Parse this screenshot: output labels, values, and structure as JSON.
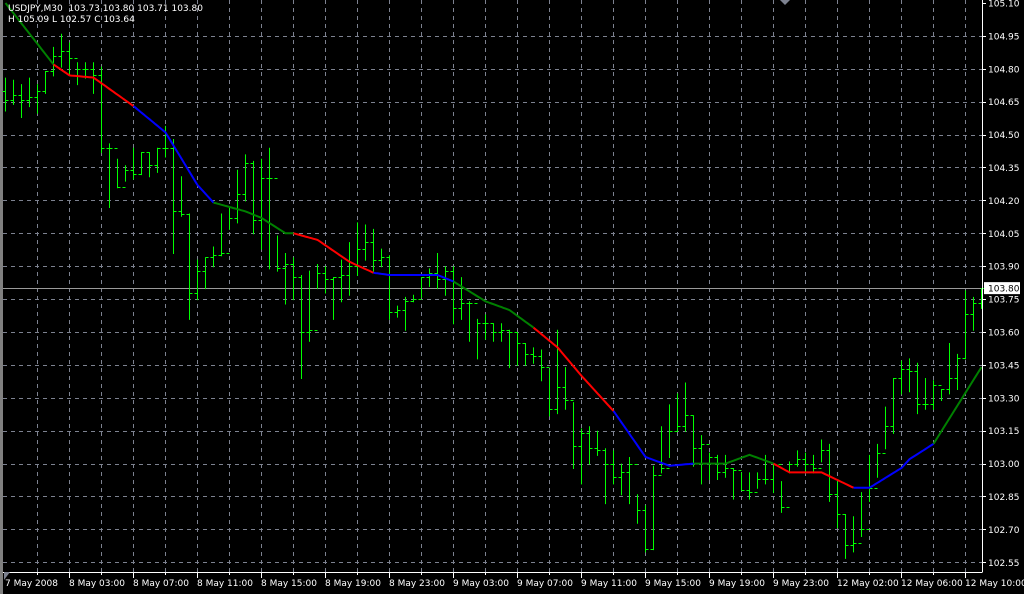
{
  "header": {
    "symbol_line": "USDJPY,M30  103.73 103.80 103.71 103.80",
    "range_line": "H 105.09 L 102.57 C 103.64"
  },
  "colors": {
    "background": "#000000",
    "bars": "#00ff00",
    "grid": "#7d8290",
    "axis": "#ffffff",
    "bid_line": "#9a9a9a",
    "ma_green": "#008000",
    "ma_red": "#ff0000",
    "ma_blue": "#0000ff"
  },
  "chart_data": {
    "type": "ohlc",
    "symbol": "USDJPY",
    "timeframe": "M30",
    "ylim": [
      102.55,
      105.1
    ],
    "grid": true,
    "price_ticks": [
      "105.10",
      "104.95",
      "104.80",
      "104.65",
      "104.50",
      "104.35",
      "104.20",
      "104.05",
      "103.90",
      "103.75",
      "103.60",
      "103.45",
      "103.30",
      "103.15",
      "103.00",
      "102.85",
      "102.70",
      "102.55"
    ],
    "current_price": "103.80",
    "time_labels": [
      "7 May 2008",
      "8 May 03:00",
      "8 May 07:00",
      "8 May 11:00",
      "8 May 15:00",
      "8 May 19:00",
      "8 May 23:00",
      "9 May 03:00",
      "9 May 07:00",
      "9 May 11:00",
      "9 May 15:00",
      "9 May 19:00",
      "9 May 23:00",
      "12 May 02:00",
      "12 May 06:00",
      "12 May 10:00"
    ],
    "bars_hlc": [
      [
        104.76,
        104.61,
        104.66
      ],
      [
        104.75,
        104.64,
        104.68
      ],
      [
        104.73,
        104.58,
        104.66
      ],
      [
        104.76,
        104.63,
        104.67
      ],
      [
        104.73,
        104.6,
        104.7
      ],
      [
        104.79,
        104.69,
        104.79
      ],
      [
        104.9,
        104.77,
        104.86
      ],
      [
        104.96,
        104.81,
        104.88
      ],
      [
        104.92,
        104.78,
        104.85
      ],
      [
        104.83,
        104.73,
        104.8
      ],
      [
        104.83,
        104.76,
        104.8
      ],
      [
        104.83,
        104.69,
        104.77
      ],
      [
        104.81,
        104.42,
        104.44
      ],
      [
        104.46,
        104.17,
        104.44
      ],
      [
        104.39,
        104.26,
        104.26
      ],
      [
        104.36,
        104.29,
        104.34
      ],
      [
        104.44,
        104.3,
        104.32
      ],
      [
        104.42,
        104.32,
        104.42
      ],
      [
        104.42,
        104.31,
        104.36
      ],
      [
        104.44,
        104.33,
        104.44
      ],
      [
        104.54,
        104.4,
        104.44
      ],
      [
        104.48,
        103.96,
        104.15
      ],
      [
        104.31,
        104.13,
        104.14
      ],
      [
        104.14,
        103.66,
        103.78
      ],
      [
        103.93,
        103.75,
        103.88
      ],
      [
        103.94,
        103.8,
        103.94
      ],
      [
        103.99,
        103.9,
        103.95
      ],
      [
        104.14,
        103.95,
        103.96
      ],
      [
        104.17,
        104.07,
        104.12
      ],
      [
        104.34,
        104.1,
        104.23
      ],
      [
        104.41,
        104.2,
        104.37
      ],
      [
        104.38,
        104.05,
        104.11
      ],
      [
        104.39,
        103.98,
        104.3
      ],
      [
        104.44,
        103.89,
        104.3
      ],
      [
        104.04,
        103.88,
        103.89
      ],
      [
        103.96,
        103.73,
        103.91
      ],
      [
        103.94,
        103.75,
        103.85
      ],
      [
        103.86,
        103.39,
        103.6
      ],
      [
        103.88,
        103.56,
        103.61
      ],
      [
        103.91,
        103.8,
        103.87
      ],
      [
        103.9,
        103.78,
        103.84
      ],
      [
        103.85,
        103.66,
        103.85
      ],
      [
        103.93,
        103.74,
        103.86
      ],
      [
        104.01,
        103.77,
        103.9
      ],
      [
        104.1,
        103.86,
        103.98
      ],
      [
        104.09,
        103.93,
        104.01
      ],
      [
        104.07,
        103.88,
        103.93
      ],
      [
        103.98,
        103.9,
        103.94
      ],
      [
        103.95,
        103.66,
        103.69
      ],
      [
        103.72,
        103.67,
        103.7
      ],
      [
        103.76,
        103.61,
        103.74
      ],
      [
        103.77,
        103.74,
        103.75
      ],
      [
        103.85,
        103.76,
        103.85
      ],
      [
        103.89,
        103.81,
        103.87
      ],
      [
        103.96,
        103.8,
        103.84
      ],
      [
        103.9,
        103.77,
        103.88
      ],
      [
        103.9,
        103.64,
        103.71
      ],
      [
        103.85,
        103.66,
        103.73
      ],
      [
        103.74,
        103.56,
        103.73
      ],
      [
        103.66,
        103.48,
        103.64
      ],
      [
        103.68,
        103.57,
        103.64
      ],
      [
        103.64,
        103.56,
        103.6
      ],
      [
        103.64,
        103.56,
        103.61
      ],
      [
        103.61,
        103.44,
        103.6
      ],
      [
        103.6,
        103.45,
        103.55
      ],
      [
        103.55,
        103.45,
        103.5
      ],
      [
        103.53,
        103.46,
        103.49
      ],
      [
        103.52,
        103.38,
        103.44
      ],
      [
        103.43,
        103.22,
        103.25
      ],
      [
        103.61,
        103.23,
        103.35
      ],
      [
        103.44,
        103.25,
        103.29
      ],
      [
        103.28,
        102.98,
        103.08
      ],
      [
        103.16,
        102.91,
        103.14
      ],
      [
        103.17,
        103.0,
        103.07
      ],
      [
        103.15,
        103.04,
        103.06
      ],
      [
        103.07,
        102.82,
        103.0
      ],
      [
        103.06,
        102.91,
        102.94
      ],
      [
        103.0,
        102.86,
        102.96
      ],
      [
        103.03,
        102.82,
        103.0
      ],
      [
        102.86,
        102.73,
        102.79
      ],
      [
        102.81,
        102.6,
        102.61
      ],
      [
        102.99,
        102.61,
        102.95
      ],
      [
        103.17,
        102.96,
        102.98
      ],
      [
        103.27,
        103.03,
        103.15
      ],
      [
        103.32,
        103.15,
        103.17
      ],
      [
        103.37,
        103.15,
        103.22
      ],
      [
        103.22,
        102.99,
        103.07
      ],
      [
        103.13,
        102.91,
        103.09
      ],
      [
        103.05,
        102.93,
        103.03
      ],
      [
        103.04,
        102.93,
        102.96
      ],
      [
        103.04,
        102.94,
        102.98
      ],
      [
        102.98,
        102.84,
        102.97
      ],
      [
        102.96,
        102.88,
        102.88
      ],
      [
        102.96,
        102.84,
        102.87
      ],
      [
        102.96,
        102.89,
        102.93
      ],
      [
        103.04,
        102.91,
        102.93
      ],
      [
        103.0,
        102.87,
        103.0
      ],
      [
        102.92,
        102.78,
        102.8
      ],
      [
        103.01,
        102.96,
        103.0
      ],
      [
        103.06,
        102.99,
        103.02
      ],
      [
        103.05,
        102.96,
        103.0
      ],
      [
        103.04,
        102.96,
        102.98
      ],
      [
        103.11,
        103.01,
        103.06
      ],
      [
        103.09,
        102.83,
        102.86
      ],
      [
        102.92,
        102.71,
        102.77
      ],
      [
        102.77,
        102.57,
        102.63
      ],
      [
        102.76,
        102.6,
        102.64
      ],
      [
        102.87,
        102.67,
        102.7
      ],
      [
        103.04,
        102.83,
        102.89
      ],
      [
        103.09,
        102.94,
        103.05
      ],
      [
        103.26,
        103.07,
        103.17
      ],
      [
        103.39,
        103.14,
        103.39
      ],
      [
        103.47,
        103.32,
        103.43
      ],
      [
        103.48,
        103.33,
        103.42
      ],
      [
        103.46,
        103.23,
        103.27
      ],
      [
        103.39,
        103.25,
        103.27
      ],
      [
        103.38,
        103.25,
        103.36
      ],
      [
        103.34,
        103.29,
        103.34
      ],
      [
        103.55,
        103.32,
        103.39
      ],
      [
        103.5,
        103.34,
        103.48
      ],
      [
        103.79,
        103.48,
        103.68
      ],
      [
        103.76,
        103.61,
        103.73
      ],
      [
        103.8,
        103.71,
        103.8
      ]
    ],
    "first_open": 104.7,
    "moving_average": {
      "points": [
        [
          0,
          105.1
        ],
        [
          6,
          104.82
        ],
        [
          8,
          104.77
        ],
        [
          11,
          104.76
        ],
        [
          16,
          104.63
        ],
        [
          20,
          104.51
        ],
        [
          24,
          104.27
        ],
        [
          26,
          104.19
        ],
        [
          30,
          104.15
        ],
        [
          32,
          104.12
        ],
        [
          35,
          104.05
        ],
        [
          36,
          104.05
        ],
        [
          39,
          104.02
        ],
        [
          43,
          103.92
        ],
        [
          46,
          103.87
        ],
        [
          48,
          103.86
        ],
        [
          54,
          103.86
        ],
        [
          56,
          103.83
        ],
        [
          60,
          103.74
        ],
        [
          63,
          103.7
        ],
        [
          66,
          103.62
        ],
        [
          69,
          103.53
        ],
        [
          72,
          103.4
        ],
        [
          76,
          103.24
        ],
        [
          80,
          103.03
        ],
        [
          83,
          102.99
        ],
        [
          86,
          103.0
        ],
        [
          90,
          103.0
        ],
        [
          93,
          103.04
        ],
        [
          96,
          103.0
        ],
        [
          98,
          102.96
        ],
        [
          102,
          102.96
        ],
        [
          106,
          102.89
        ],
        [
          108,
          102.89
        ],
        [
          112,
          102.98
        ],
        [
          113,
          103.02
        ],
        [
          116,
          103.09
        ],
        [
          122,
          103.44
        ]
      ],
      "segments": [
        [
          0,
          6,
          "green"
        ],
        [
          6,
          16,
          "red"
        ],
        [
          16,
          26,
          "blue"
        ],
        [
          26,
          36,
          "green"
        ],
        [
          36,
          46,
          "red"
        ],
        [
          46,
          56,
          "blue"
        ],
        [
          56,
          66,
          "green"
        ],
        [
          66,
          76,
          "red"
        ],
        [
          76,
          86,
          "blue"
        ],
        [
          86,
          96,
          "green"
        ],
        [
          96,
          106,
          "red"
        ],
        [
          106,
          116,
          "blue"
        ],
        [
          116,
          122,
          "green"
        ]
      ]
    }
  }
}
